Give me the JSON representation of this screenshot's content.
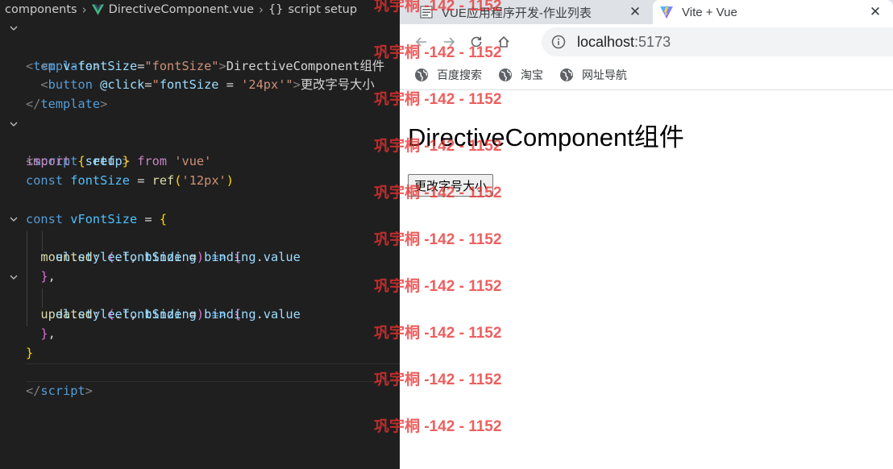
{
  "editor": {
    "breadcrumb": {
      "folder": "components",
      "file": "DirectiveComponent.vue",
      "symbol": "script setup",
      "symbol_icon": "braces-icon"
    }
  },
  "browser": {
    "tabs": [
      {
        "title": "VUE应用程序开发-作业列表",
        "favicon": "document-icon",
        "active": false
      },
      {
        "title": "Vite + Vue",
        "favicon": "vite-logo-icon",
        "active": true
      }
    ],
    "address": {
      "host": "localhost",
      "port": ":5173"
    },
    "bookmarks": [
      {
        "label": "百度搜索",
        "icon": "globe-icon"
      },
      {
        "label": "淘宝",
        "icon": "globe-icon"
      },
      {
        "label": "网址导航",
        "icon": "globe-icon"
      }
    ],
    "page": {
      "heading": "DirectiveComponent组件",
      "button_label": "更改字号大小"
    }
  },
  "watermark": {
    "text": "巩宇桐 -142 - 1152",
    "color": "#e83232"
  },
  "colors": {
    "editor_bg": "#1f1f1f",
    "tag": "#569cd6",
    "attribute": "#9cdcfe",
    "string": "#ce9178",
    "keyword": "#c586c0",
    "function": "#dcdcaa",
    "tab_strip": "#dee1e6"
  }
}
